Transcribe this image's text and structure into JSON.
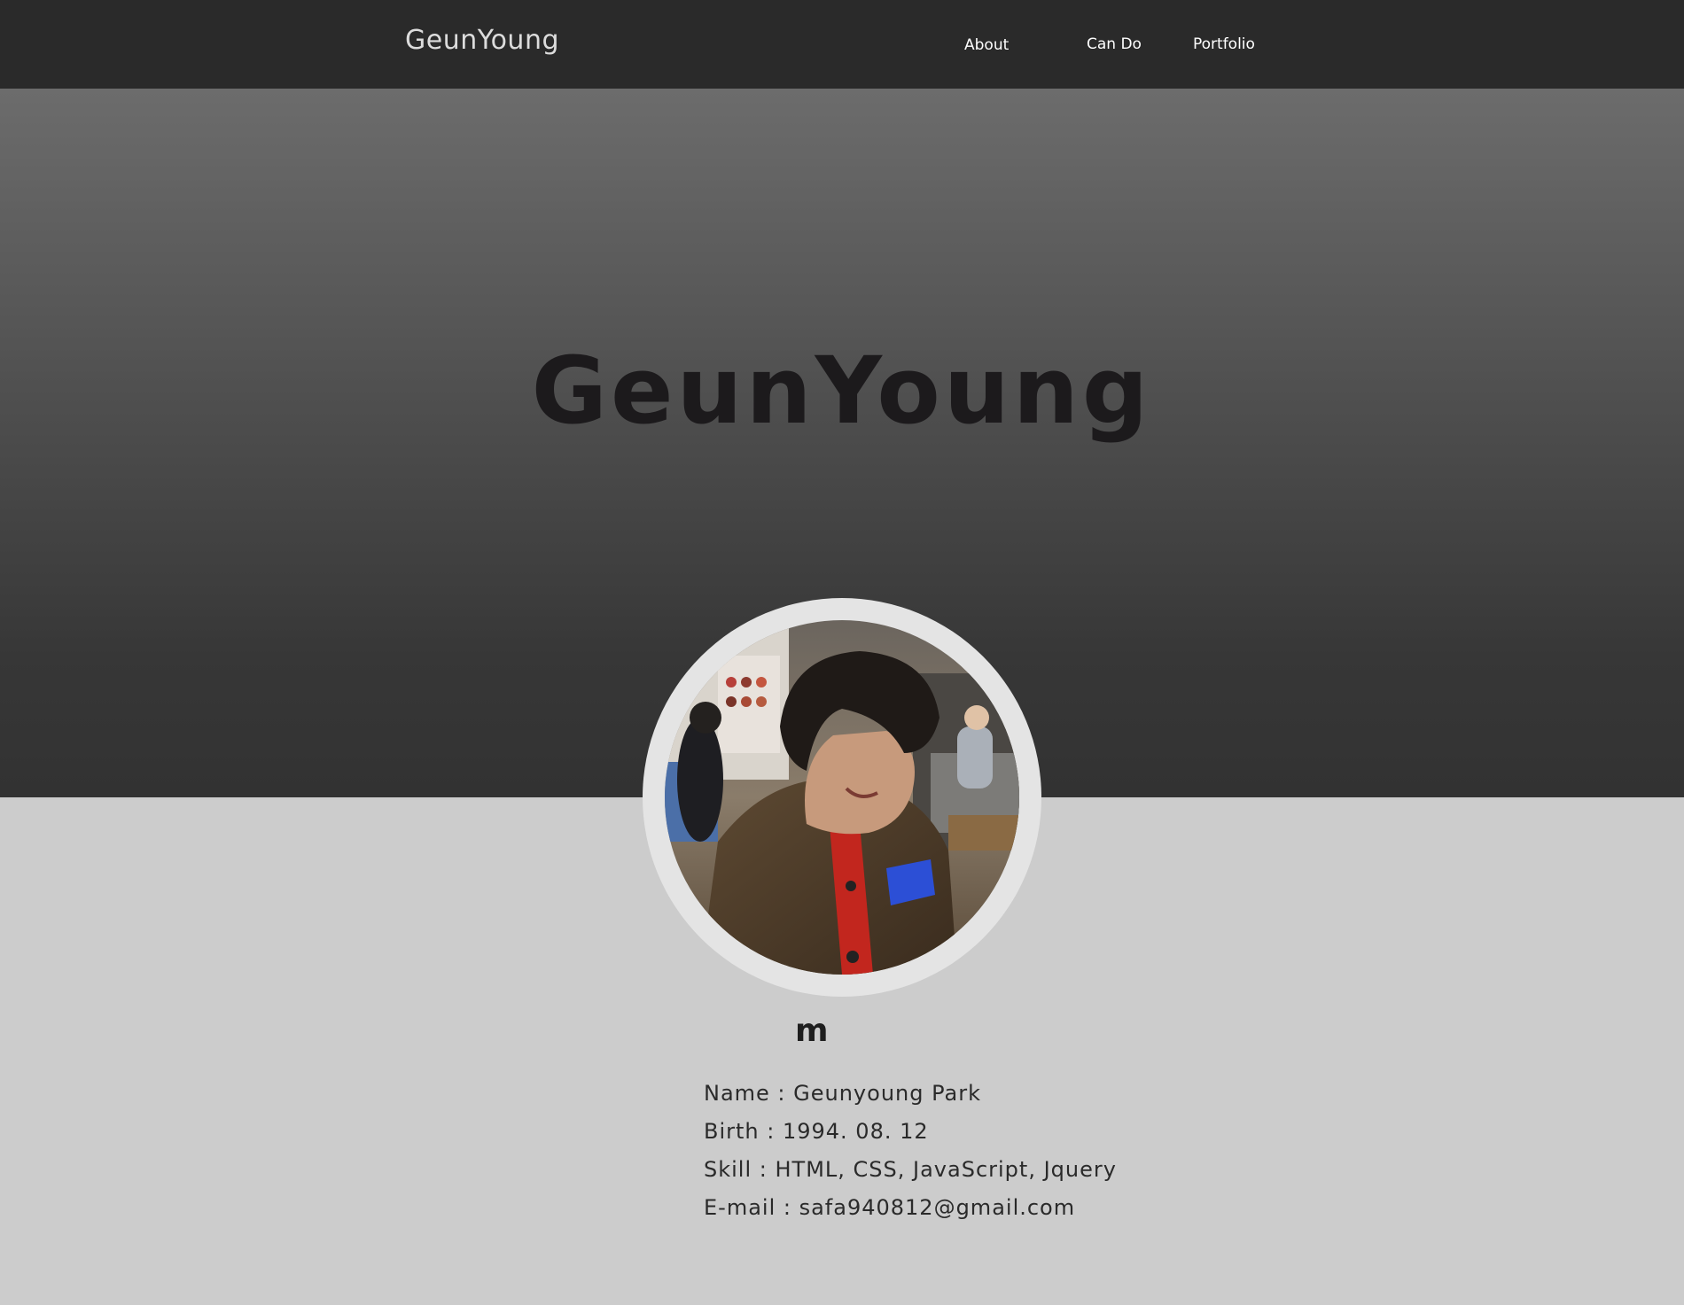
{
  "navbar": {
    "brand": "GeunYoung",
    "links": [
      {
        "label": "About"
      },
      {
        "label": "Can Do"
      },
      {
        "label": "Portfolio"
      }
    ]
  },
  "hero": {
    "title": "GeunYoung"
  },
  "about": {
    "heading": "m",
    "info": [
      "Name : Geunyoung Park",
      "Birth : 1994. 08. 12",
      "Skill : HTML, CSS, JavaScript, Jquery",
      "E-mail : safa940812@gmail.com"
    ]
  },
  "colors": {
    "navbar_bg": "#2a2a2a",
    "hero_top": "#6c6c6c",
    "hero_bottom": "#323232",
    "page_bg": "#cccccc",
    "ring": "#e4e4e4"
  }
}
